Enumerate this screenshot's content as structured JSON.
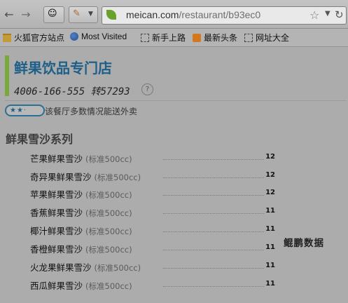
{
  "browser": {
    "url_domain": "meican.com",
    "url_path": "/restaurant/b93ec0",
    "icons": {
      "back": "back-arrow-icon",
      "forward": "forward-arrow-icon",
      "addon": "addon-face-icon",
      "pencil": "pencil-icon",
      "site": "leaf-icon",
      "star": "star-icon",
      "refresh": "refresh-icon"
    }
  },
  "bookmarks": [
    {
      "label": "火狐官方站点",
      "icon": "folder-icon"
    },
    {
      "label": "Most Visited",
      "icon": "globe-icon"
    },
    {
      "label": "新手上路",
      "icon": "page-icon"
    },
    {
      "label": "最新头条",
      "icon": "rss-icon"
    },
    {
      "label": "网址大全",
      "icon": "page-icon"
    }
  ],
  "restaurant": {
    "name": "鲜果饮品专门店",
    "phone": "4006-166-555 转57293",
    "help": "?",
    "rating": "★★·",
    "delivery_note": "该餐厅多数情况能送外卖"
  },
  "menu": {
    "category": "鲜果雪沙系列",
    "items": [
      {
        "name": "芒果鲜果雪沙",
        "spec": "(标准500cc)",
        "price": "12"
      },
      {
        "name": "奇异果鲜果雪沙",
        "spec": "(标准500cc)",
        "price": "12"
      },
      {
        "name": "苹果鲜果雪沙",
        "spec": "(标准500cc)",
        "price": "12"
      },
      {
        "name": "香蕉鲜果雪沙",
        "spec": "(标准500cc)",
        "price": "11"
      },
      {
        "name": "椰汁鲜果雪沙",
        "spec": "(标准500cc)",
        "price": "11"
      },
      {
        "name": "香橙鲜果雪沙",
        "spec": "(标准500cc)",
        "price": "11"
      },
      {
        "name": "火龙果鲜果雪沙",
        "spec": "(标准500cc)",
        "price": "11"
      },
      {
        "name": "西瓜鲜果雪沙",
        "spec": "(标准500cc)",
        "price": "11"
      }
    ]
  },
  "watermark": "鲲鹏数据",
  "colors": {
    "accent_bar": "#79a93a",
    "title": "#1d5f88"
  }
}
